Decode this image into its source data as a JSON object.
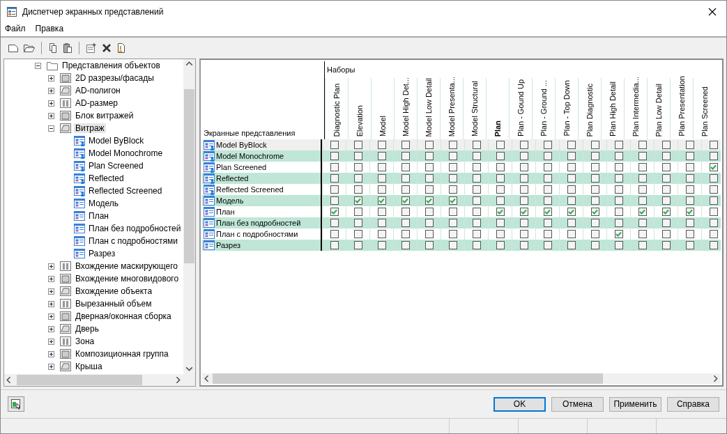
{
  "window": {
    "title": "Диспетчер экранных представлений"
  },
  "menu": [
    {
      "label": "Файл"
    },
    {
      "label": "Правка"
    }
  ],
  "tree": {
    "items": [
      {
        "label": "Представления объектов",
        "kind": "folder",
        "expanded": true,
        "children": [
          {
            "label": "2D разрезы/фасады",
            "kind": "category",
            "expanded": false,
            "selected": false
          },
          {
            "label": "AD-полигон",
            "kind": "category",
            "expanded": false,
            "selected": false
          },
          {
            "label": "AD-размер",
            "kind": "category",
            "expanded": false,
            "selected": false
          },
          {
            "label": "Блок витражей",
            "kind": "category",
            "expanded": false,
            "selected": false
          },
          {
            "label": "Витраж",
            "kind": "category",
            "expanded": true,
            "selected": true,
            "children": [
              {
                "label": "Model ByBlock",
                "kind": "override"
              },
              {
                "label": "Model Monochrome",
                "kind": "override"
              },
              {
                "label": "Plan Screened",
                "kind": "override"
              },
              {
                "label": "Reflected",
                "kind": "override"
              },
              {
                "label": "Reflected Screened",
                "kind": "override"
              },
              {
                "label": "Модель",
                "kind": "rep"
              },
              {
                "label": "План",
                "kind": "rep"
              },
              {
                "label": "План без подробностей",
                "kind": "rep"
              },
              {
                "label": "План с подробностями",
                "kind": "rep"
              },
              {
                "label": "Разрез",
                "kind": "rep"
              }
            ]
          },
          {
            "label": "Вхождение маскирующего",
            "kind": "category",
            "expanded": false,
            "selected": false
          },
          {
            "label": "Вхождение многовидового",
            "kind": "category",
            "expanded": false,
            "selected": false
          },
          {
            "label": "Вхождение объекта",
            "kind": "category",
            "expanded": false,
            "selected": false
          },
          {
            "label": "Вырезанный объем",
            "kind": "category",
            "expanded": false,
            "selected": false
          },
          {
            "label": "Дверная/оконная сборка",
            "kind": "category",
            "expanded": false,
            "selected": false
          },
          {
            "label": "Дверь",
            "kind": "category",
            "expanded": false,
            "selected": false
          },
          {
            "label": "Зона",
            "kind": "category",
            "expanded": false,
            "selected": false
          },
          {
            "label": "Композиционная группа",
            "kind": "category",
            "expanded": false,
            "selected": false
          },
          {
            "label": "Крыша",
            "kind": "category",
            "expanded": false,
            "selected": false
          }
        ]
      }
    ]
  },
  "grid": {
    "row_header": "Экранные представления",
    "group_header": "Наборы",
    "columns": [
      {
        "label": "Diagnostic Plan",
        "bold": false
      },
      {
        "label": "Elevation",
        "bold": false
      },
      {
        "label": "Model",
        "bold": false
      },
      {
        "label": "Model High Det...",
        "bold": false
      },
      {
        "label": "Model Low Detail",
        "bold": false
      },
      {
        "label": "Model Presenta...",
        "bold": false
      },
      {
        "label": "Model Structural",
        "bold": false
      },
      {
        "label": "Plan",
        "bold": true
      },
      {
        "label": "Plan - Gound Up",
        "bold": false
      },
      {
        "label": "Plan - Ground ...",
        "bold": false
      },
      {
        "label": "Plan - Top Down",
        "bold": false
      },
      {
        "label": "Plan Diagnostic",
        "bold": false
      },
      {
        "label": "Plan High Detail",
        "bold": false
      },
      {
        "label": "Plan Intermedia...",
        "bold": false
      },
      {
        "label": "Plan Low Detail",
        "bold": false
      },
      {
        "label": "Plan Presentation",
        "bold": false
      },
      {
        "label": "Plan Screened",
        "bold": false
      }
    ],
    "rows": [
      {
        "label": "Model ByBlock",
        "kind": "override",
        "selected": true,
        "checked": [
          false,
          false,
          false,
          false,
          false,
          false,
          false,
          false,
          false,
          false,
          false,
          false,
          false,
          false,
          false,
          false,
          false
        ]
      },
      {
        "label": "Model Monochrome",
        "kind": "override",
        "selected": false,
        "checked": [
          false,
          false,
          false,
          false,
          false,
          false,
          false,
          false,
          false,
          false,
          false,
          false,
          false,
          false,
          false,
          false,
          false
        ]
      },
      {
        "label": "Plan Screened",
        "kind": "override",
        "selected": false,
        "checked": [
          false,
          false,
          false,
          false,
          false,
          false,
          false,
          false,
          false,
          false,
          false,
          false,
          false,
          false,
          false,
          false,
          true
        ]
      },
      {
        "label": "Reflected",
        "kind": "override",
        "selected": false,
        "checked": [
          false,
          false,
          false,
          false,
          false,
          false,
          false,
          false,
          false,
          false,
          false,
          false,
          false,
          false,
          false,
          false,
          false
        ]
      },
      {
        "label": "Reflected Screened",
        "kind": "override",
        "selected": false,
        "checked": [
          false,
          false,
          false,
          false,
          false,
          false,
          false,
          false,
          false,
          false,
          false,
          false,
          false,
          false,
          false,
          false,
          false
        ]
      },
      {
        "label": "Модель",
        "kind": "rep",
        "selected": false,
        "checked": [
          false,
          true,
          true,
          true,
          true,
          true,
          false,
          false,
          false,
          false,
          false,
          false,
          false,
          false,
          false,
          false,
          false
        ]
      },
      {
        "label": "План",
        "kind": "rep",
        "selected": false,
        "checked": [
          true,
          false,
          false,
          false,
          false,
          false,
          false,
          true,
          true,
          true,
          true,
          true,
          false,
          true,
          true,
          true,
          false
        ]
      },
      {
        "label": "План без подробностей",
        "kind": "rep",
        "selected": false,
        "checked": [
          false,
          false,
          false,
          false,
          false,
          false,
          false,
          false,
          false,
          false,
          false,
          false,
          false,
          false,
          false,
          false,
          false
        ]
      },
      {
        "label": "План с подробностями",
        "kind": "rep",
        "selected": false,
        "checked": [
          false,
          false,
          false,
          false,
          false,
          false,
          false,
          false,
          false,
          false,
          false,
          false,
          true,
          false,
          false,
          false,
          false
        ]
      },
      {
        "label": "Разрез",
        "kind": "rep",
        "selected": false,
        "checked": [
          false,
          false,
          false,
          false,
          false,
          false,
          false,
          false,
          false,
          false,
          false,
          false,
          false,
          false,
          false,
          false,
          false
        ]
      }
    ]
  },
  "buttons": [
    {
      "label": "OK",
      "default": true
    },
    {
      "label": "Отмена",
      "default": false
    },
    {
      "label": "Применить",
      "default": false
    },
    {
      "label": "Справка",
      "default": false
    }
  ]
}
